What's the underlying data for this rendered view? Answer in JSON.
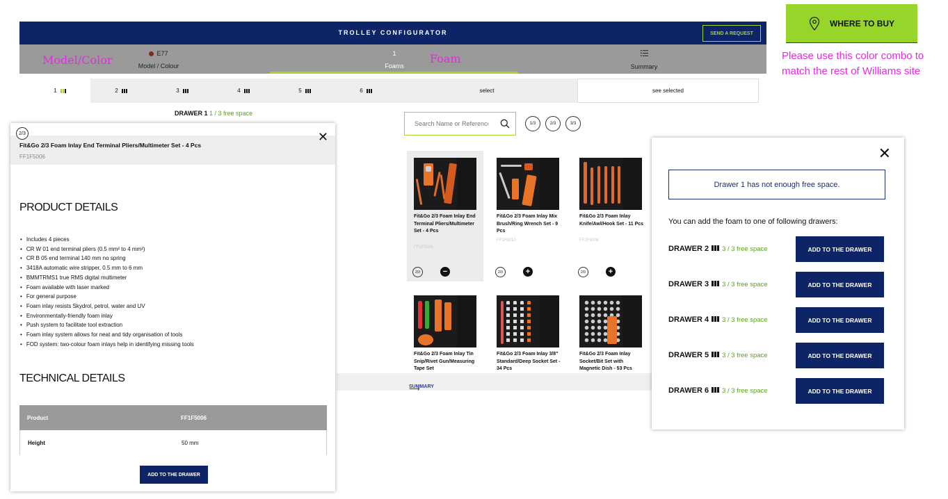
{
  "header": {
    "title": "TROLLEY CONFIGURATOR",
    "send_request": "SEND A REQUEST"
  },
  "steps": {
    "model": {
      "value": "E77",
      "label": "Model / Colour"
    },
    "foam": {
      "value": "1",
      "label": "Foams"
    },
    "summary": {
      "label": "Summary"
    }
  },
  "annotations": {
    "model_color": "Model/Color",
    "foam": "Foam",
    "note": "Please use this color combo to match the rest of Williams site"
  },
  "where_to_buy": "WHERE TO BUY",
  "drawer_tabs": [
    "1",
    "2",
    "3",
    "4",
    "5",
    "6"
  ],
  "drawer_tab_select": "select",
  "drawer_tab_see_selected": "see selected",
  "drawer_status": {
    "title": "DRAWER 1",
    "free": "1 / 3 free space"
  },
  "search": {
    "placeholder": "Search Name or Reference"
  },
  "size_filters": [
    "1/3",
    "2/3",
    "3/3"
  ],
  "products": [
    {
      "name": "Fit&Go 2/3 Foam Inlay End Terminal Pliers/Multimeter Set - 4 Pcs",
      "ref": "FF1F5006",
      "size": "2/3",
      "action": "−"
    },
    {
      "name": "Fit&Go 2/3 Foam Inlay Mix Brush/Ring Wrench Set - 9 Pcs",
      "ref": "FF1F5010",
      "size": "2/3",
      "action": "+"
    },
    {
      "name": "Fit&Go 2/3 Foam Inlay Knife/Awl/Hook Set - 11 Pcs",
      "ref": "FF1F5008",
      "size": "2/3",
      "action": "+"
    },
    {
      "name": "Fit&Go 2/3 Foam Inlay Tin Snip/Rivet Gun/Measuring Tape Set",
      "ref": "",
      "size": "",
      "action": ""
    },
    {
      "name": "Fit&Go 2/3 Foam Inlay 3/8\" Standard/Deep Socket Set - 34 Pcs",
      "ref": "",
      "size": "",
      "action": ""
    },
    {
      "name": "Fit&Go 2/3 Foam Inlay Socket/Bit Set with Magnetic Dish - 53 Pcs",
      "ref": "",
      "size": "",
      "action": ""
    }
  ],
  "summary_link": "SUMMARY",
  "detail_modal": {
    "badge": "2/3",
    "title": "Fit&Go 2/3 Foam Inlay End Terminal Pliers/Multimeter Set - 4 Pcs",
    "ref": "FF1F5006",
    "product_details_heading": "PRODUCT DETAILS",
    "details": [
      "Includes 4 pieces",
      "CR W 01 end terminal pliers (0.5 mm² to 4 mm²)",
      "CR B 05 end terminal 140 mm no spring",
      "3418A automatic wire stripper, 0.5 mm to 6 mm",
      "BMMTRMS1 true RMS digital multimeter",
      "Foam available with laser marked",
      "For general purpose",
      "Foam inlay resists Skydrol, petrol, water and UV",
      "Environmentally-friendly foam inlay",
      "Push system to facilitate tool extraction",
      "Foam inlay system allows for neat and tidy organisation of tools",
      "FOD system: two-colour foam inlays help in identifying missing tools"
    ],
    "technical_details_heading": "TECHNICAL DETAILS",
    "table": {
      "header": {
        "label": "Product",
        "value": "FF1F5006"
      },
      "rows": [
        {
          "label": "Height",
          "value": "50 mm"
        }
      ]
    },
    "add_button": "ADD TO THE DRAWER"
  },
  "space_modal": {
    "warning": "Drawer 1 has not enough free space.",
    "text": "You can add the foam to one of following drawers:",
    "drawers": [
      {
        "label": "DRAWER 2",
        "free": "3 / 3 free space",
        "button": "ADD TO THE DRAWER"
      },
      {
        "label": "DRAWER 3",
        "free": "3 / 3 free space",
        "button": "ADD TO THE DRAWER"
      },
      {
        "label": "DRAWER 4",
        "free": "3 / 3 free space",
        "button": "ADD TO THE DRAWER"
      },
      {
        "label": "DRAWER 5",
        "free": "3 / 3 free space",
        "button": "ADD TO THE DRAWER"
      },
      {
        "label": "DRAWER 6",
        "free": "3 / 3 free space",
        "button": "ADD TO THE DRAWER"
      }
    ]
  },
  "colors": {
    "navy": "#0d2466",
    "lime": "#a6d32a",
    "green_text": "#5ba21c",
    "step_grey": "#9a9a9a",
    "annotation": "#e62ae0"
  }
}
